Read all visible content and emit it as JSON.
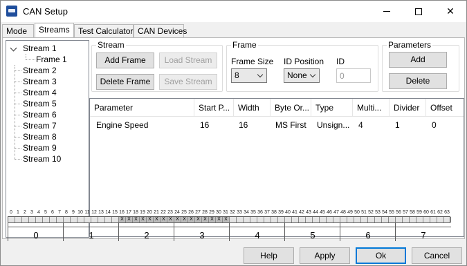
{
  "window": {
    "title": "CAN Setup",
    "accent": "#0078d7"
  },
  "tabs": [
    {
      "label": "Mode"
    },
    {
      "label": "Streams"
    },
    {
      "label": "Test Calculator"
    },
    {
      "label": "CAN Devices"
    }
  ],
  "active_tab": "Streams",
  "tree": {
    "items": [
      {
        "label": "Stream 1"
      },
      {
        "label": "Frame 1"
      },
      {
        "label": "Stream 2"
      },
      {
        "label": "Stream 3"
      },
      {
        "label": "Stream 4"
      },
      {
        "label": "Stream 5"
      },
      {
        "label": "Stream 6"
      },
      {
        "label": "Stream 7"
      },
      {
        "label": "Stream 8"
      },
      {
        "label": "Stream 9"
      },
      {
        "label": "Stream 10"
      }
    ]
  },
  "stream_group": {
    "label": "Stream",
    "add_frame": "Add Frame",
    "load_stream": "Load Stream",
    "delete_frame": "Delete Frame",
    "save_stream": "Save Stream"
  },
  "frame_group": {
    "label": "Frame",
    "frame_size_label": "Frame Size",
    "frame_size_value": "8",
    "id_position_label": "ID Position",
    "id_position_value": "None",
    "id_label": "ID",
    "id_placeholder": "0"
  },
  "parameters_group": {
    "label": "Parameters",
    "add": "Add",
    "delete": "Delete"
  },
  "grid": {
    "columns": [
      "Parameter",
      "Start P...",
      "Width",
      "Byte Or...",
      "Type",
      "Multi...",
      "Divider",
      "Offset"
    ],
    "rows": [
      [
        "Engine Speed",
        "16",
        "16",
        "MS First",
        "Unsign...",
        "4",
        "1",
        "0"
      ]
    ]
  },
  "bitmap": {
    "bit_numbers": [
      "0",
      "1",
      "2",
      "3",
      "4",
      "5",
      "6",
      "7",
      "8",
      "9",
      "10",
      "11",
      "12",
      "13",
      "14",
      "15",
      "16",
      "17",
      "18",
      "19",
      "20",
      "21",
      "22",
      "23",
      "24",
      "25",
      "26",
      "27",
      "28",
      "29",
      "30",
      "31",
      "32",
      "33",
      "34",
      "35",
      "36",
      "37",
      "38",
      "39",
      "40",
      "41",
      "42",
      "43",
      "44",
      "45",
      "46",
      "47",
      "48",
      "49",
      "50",
      "51",
      "52",
      "53",
      "54",
      "55",
      "56",
      "57",
      "58",
      "59",
      "60",
      "61",
      "62",
      "63"
    ],
    "used_bits_mark": "X",
    "used_bit_start": 16,
    "used_bit_end": 31,
    "bytes": [
      "0",
      "1",
      "2",
      "3",
      "4",
      "5",
      "6",
      "7"
    ]
  },
  "footer": {
    "help": "Help",
    "apply": "Apply",
    "ok": "Ok",
    "cancel": "Cancel"
  }
}
